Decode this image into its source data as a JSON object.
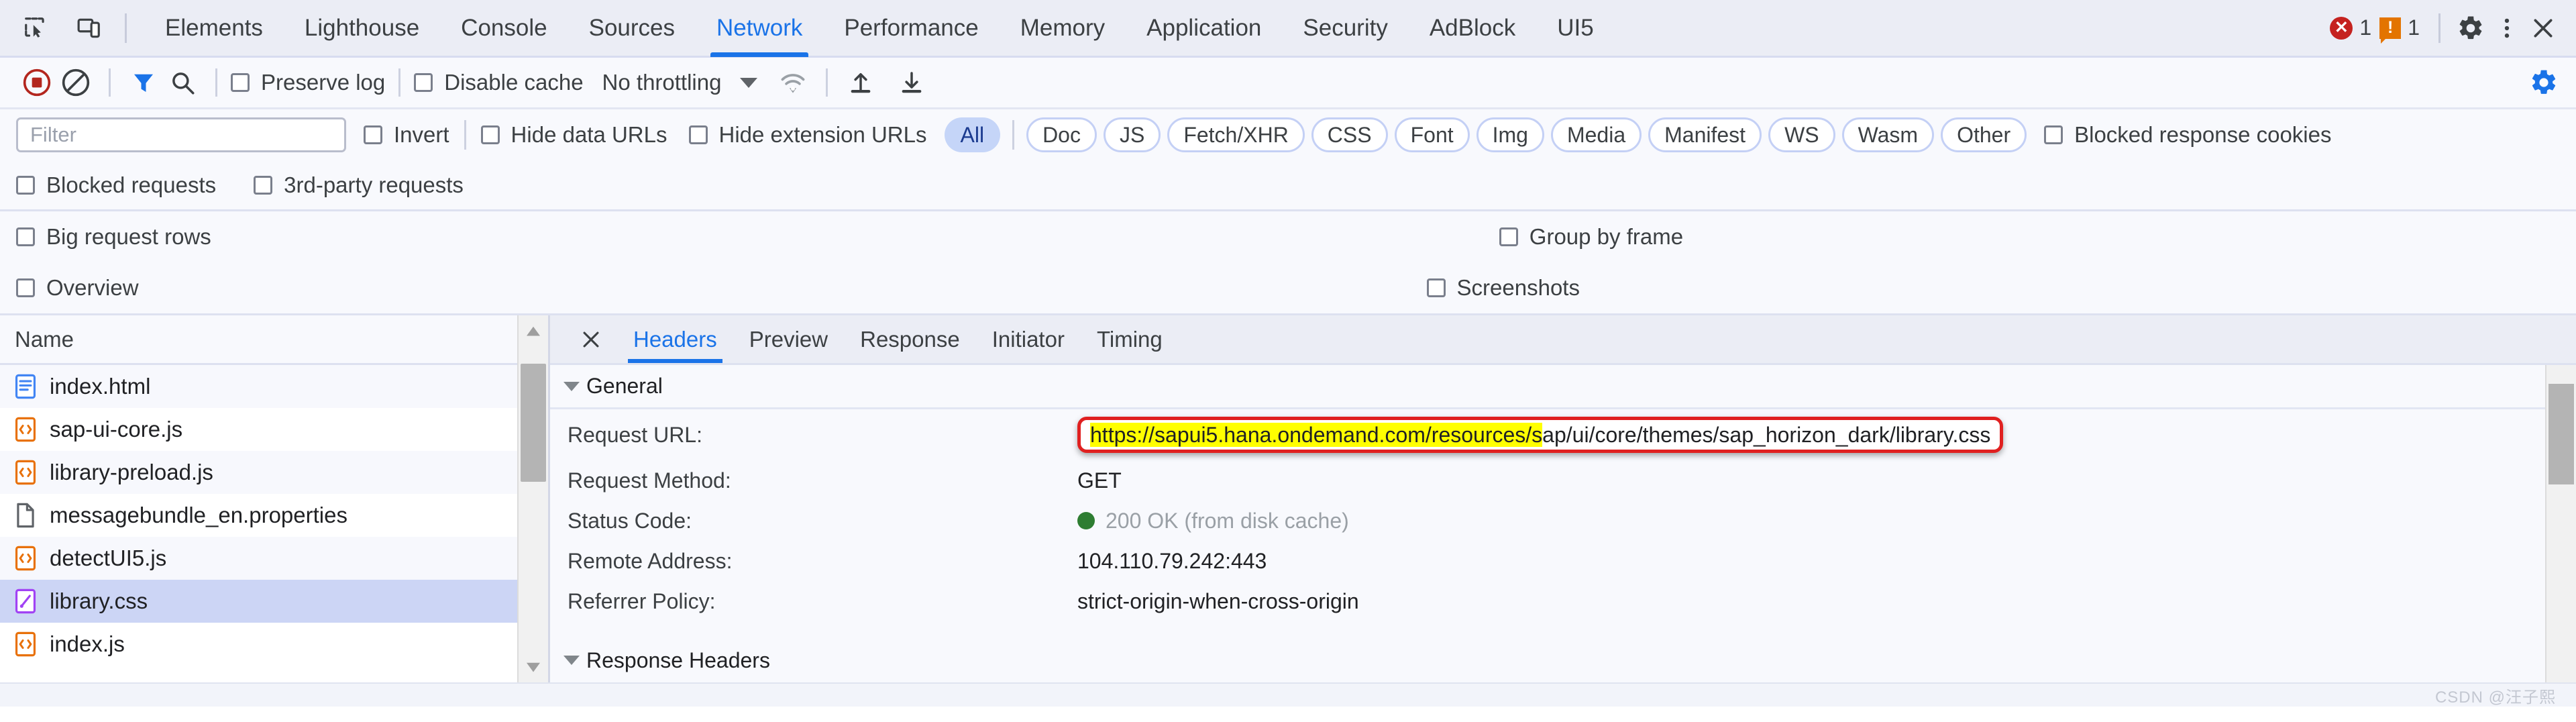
{
  "tabbar": {
    "icons": [
      {
        "name": "inspect-element-icon"
      },
      {
        "name": "device-toolbar-icon"
      }
    ],
    "tabs": [
      {
        "label": "Elements",
        "active": false
      },
      {
        "label": "Lighthouse",
        "active": false
      },
      {
        "label": "Console",
        "active": false
      },
      {
        "label": "Sources",
        "active": false
      },
      {
        "label": "Network",
        "active": true
      },
      {
        "label": "Performance",
        "active": false
      },
      {
        "label": "Memory",
        "active": false
      },
      {
        "label": "Application",
        "active": false
      },
      {
        "label": "Security",
        "active": false
      },
      {
        "label": "AdBlock",
        "active": false
      },
      {
        "label": "UI5",
        "active": false
      }
    ],
    "error_count": "1",
    "warning_count": "1",
    "error_glyph": "✕",
    "warning_glyph": "!",
    "settings_icon": "gear-icon",
    "more_icon": "kebab-menu-icon",
    "close_icon": "close-icon",
    "accent": "#1a73e8"
  },
  "network_toolbar": {
    "record_icon": "record-stop-icon",
    "clear_icon": "clear-icon",
    "filter_icon": "filter-funnel-icon",
    "search_icon": "search-icon",
    "preserve_log": "Preserve log",
    "disable_cache": "Disable cache",
    "throttling": "No throttling",
    "wifi_icon": "network-conditions-icon",
    "import_icon": "import-har-icon",
    "export_icon": "export-har-icon",
    "settings_icon": "network-settings-gear-icon"
  },
  "filter_row": {
    "filter_placeholder": "Filter",
    "invert": "Invert",
    "hide_data_urls": "Hide data URLs",
    "hide_extension_urls": "Hide extension URLs",
    "types": [
      {
        "label": "All",
        "selected": true
      },
      {
        "label": "Doc",
        "selected": false
      },
      {
        "label": "JS",
        "selected": false
      },
      {
        "label": "Fetch/XHR",
        "selected": false
      },
      {
        "label": "CSS",
        "selected": false
      },
      {
        "label": "Font",
        "selected": false
      },
      {
        "label": "Img",
        "selected": false
      },
      {
        "label": "Media",
        "selected": false
      },
      {
        "label": "Manifest",
        "selected": false
      },
      {
        "label": "WS",
        "selected": false
      },
      {
        "label": "Wasm",
        "selected": false
      },
      {
        "label": "Other",
        "selected": false
      }
    ],
    "blocked_response_cookies": "Blocked response cookies"
  },
  "options_rows": {
    "blocked_requests": "Blocked requests",
    "third_party_requests": "3rd-party requests",
    "big_request_rows": "Big request rows",
    "group_by_frame": "Group by frame",
    "overview": "Overview",
    "screenshots": "Screenshots"
  },
  "request_list": {
    "column_header": "Name",
    "rows": [
      {
        "name": "index.html",
        "icon": "html-document-icon",
        "selected": false
      },
      {
        "name": "sap-ui-core.js",
        "icon": "script-icon",
        "selected": false
      },
      {
        "name": "library-preload.js",
        "icon": "script-icon",
        "selected": false
      },
      {
        "name": "messagebundle_en.properties",
        "icon": "generic-file-icon",
        "selected": false
      },
      {
        "name": "detectUI5.js",
        "icon": "script-icon",
        "selected": false
      },
      {
        "name": "library.css",
        "icon": "stylesheet-icon",
        "selected": true
      },
      {
        "name": "index.js",
        "icon": "script-icon",
        "selected": false
      }
    ]
  },
  "detail_panel": {
    "close_icon": "close-icon",
    "tabs": [
      {
        "label": "Headers",
        "active": true
      },
      {
        "label": "Preview",
        "active": false
      },
      {
        "label": "Response",
        "active": false
      },
      {
        "label": "Initiator",
        "active": false
      },
      {
        "label": "Timing",
        "active": false
      }
    ],
    "general_section": "General",
    "response_headers_section": "Response Headers",
    "fields": [
      {
        "key": "Request URL:",
        "value": ""
      },
      {
        "key": "Request Method:",
        "value": "GET"
      },
      {
        "key": "Status Code:",
        "value": "200 OK (from disk cache)"
      },
      {
        "key": "Remote Address:",
        "value": "104.110.79.242:443"
      },
      {
        "key": "Referrer Policy:",
        "value": "strict-origin-when-cross-origin"
      }
    ],
    "request_url": {
      "highlighted_part": "https://sapui5.hana.ondemand.com/resources/s",
      "plain_part": "ap/ui/core/themes/sap_horizon_dark/library.css",
      "highlight_color": "#ffff00",
      "annotation_border_color": "#e02020"
    },
    "status_dot_color": "#2e7d32"
  },
  "watermark": "CSDN @汪子熙"
}
